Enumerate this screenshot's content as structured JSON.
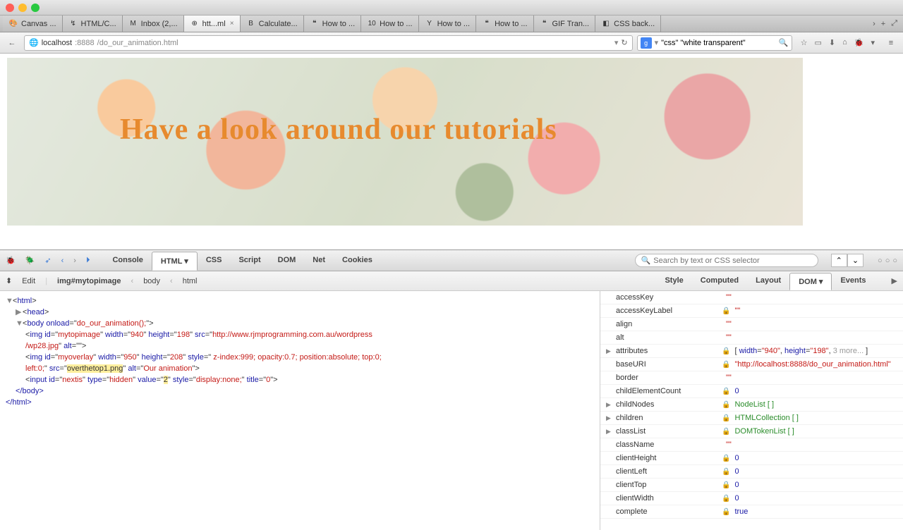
{
  "window": {
    "title": "Firefox"
  },
  "tabs": {
    "items": [
      {
        "label": "Canvas ...",
        "fav": "🎨"
      },
      {
        "label": "HTML/C...",
        "fav": "↯"
      },
      {
        "label": "Inbox (2,...",
        "fav": "M"
      },
      {
        "label": "htt...ml",
        "fav": "⊕",
        "active": true
      },
      {
        "label": "Calculate...",
        "fav": "B"
      },
      {
        "label": "How to ...",
        "fav": "❝"
      },
      {
        "label": "How to ...",
        "fav": "10"
      },
      {
        "label": "How to ...",
        "fav": "Y"
      },
      {
        "label": "How to ...",
        "fav": "❝"
      },
      {
        "label": "GIF Tran...",
        "fav": "❝"
      },
      {
        "label": "CSS back...",
        "fav": "◧"
      }
    ],
    "chev": "›",
    "plus": "+",
    "full": "⤢"
  },
  "addr": {
    "back": "←",
    "globe": "🌐",
    "host": "localhost",
    "port": ":8888",
    "path": "/do_our_animation.html",
    "reload": "↻",
    "dd": "▾"
  },
  "search": {
    "engine": "g",
    "value": "\"css\" \"white transparent\"",
    "go": "🔍"
  },
  "tbicons": [
    "☆",
    "▭",
    "⬇",
    "⌂",
    "🐞",
    "▾"
  ],
  "menu": "≡",
  "banner": {
    "text": "Have a look around our tutorials"
  },
  "devtools": {
    "leftIcons": [
      "🐞",
      "🪲",
      "🔍",
      "‹",
      "›",
      "⏵"
    ],
    "tabs": [
      "Console",
      "HTML",
      "CSS",
      "Script",
      "DOM",
      "Net",
      "Cookies"
    ],
    "activeTab": "HTML",
    "searchPlaceholder": "Search by text or CSS selector",
    "navUp": "⌃",
    "navDown": "⌄",
    "mini": [
      "○",
      "○",
      "○"
    ],
    "crumbs": {
      "edit": "Edit",
      "el": "img#mytopimage",
      "body": "body",
      "html": "html",
      "arrow": "‹"
    },
    "rightTabs": [
      "Style",
      "Computed",
      "Layout",
      "DOM",
      "Events"
    ],
    "rightActive": "DOM",
    "play": "▶"
  },
  "source": {
    "l1a": "<",
    "l1b": "html",
    "l1c": ">",
    "l2a": "<",
    "l2b": "head",
    "l2c": ">",
    "l3a": "<",
    "l3b": "body",
    "l3c": " onload",
    "l3d": "=\"",
    "l3e": "do_our_animation();",
    "l3f": "\">",
    "l4": "<img id=\"mytopimage\" width=\"940\" height=\"198\" src=\"http://www.rjmprogramming.com.au/wordpress/wp28.jpg\" alt=\"\">",
    "l5a": "<img id=\"myoverlay\" width=\"950\" height=\"208\" style=\" z-index:999; opacity:0.7; position:absolute; top:0; left:0;\" src=\"",
    "l5b": "overthetop1.png",
    "l5c": "\" alt=\"Our animation\">",
    "l6a": "<input id=\"nextis\" type=\"hidden\" value=\"",
    "l6b": "2",
    "l6c": "\" style=\"display:none;\" title=\"0\">",
    "l7": "</body>",
    "l8": "</html>"
  },
  "props": [
    {
      "k": "accessKey",
      "t": "str",
      "v": "\"\""
    },
    {
      "k": "accessKeyLabel",
      "t": "str",
      "v": "\"\"",
      "lock": true
    },
    {
      "k": "align",
      "t": "str",
      "v": "\"\""
    },
    {
      "k": "alt",
      "t": "str",
      "v": "\"\""
    },
    {
      "k": "attributes",
      "t": "attr",
      "v": "[ width=\"940\", height=\"198\", 3 more...]",
      "exp": true,
      "lock": true
    },
    {
      "k": "baseURI",
      "t": "str",
      "v": "\"http://localhost:8888/do_our_animation.html\"",
      "lock": true
    },
    {
      "k": "border",
      "t": "str",
      "v": "\"\""
    },
    {
      "k": "childElementCount",
      "t": "num",
      "v": "0",
      "lock": true
    },
    {
      "k": "childNodes",
      "t": "obj",
      "v": "NodeList [ ]",
      "exp": true,
      "lock": true
    },
    {
      "k": "children",
      "t": "obj",
      "v": "HTMLCollection [ ]",
      "exp": true,
      "lock": true
    },
    {
      "k": "classList",
      "t": "obj",
      "v": "DOMTokenList [ ]",
      "exp": true,
      "lock": true
    },
    {
      "k": "className",
      "t": "str",
      "v": "\"\""
    },
    {
      "k": "clientHeight",
      "t": "num",
      "v": "0",
      "lock": true
    },
    {
      "k": "clientLeft",
      "t": "num",
      "v": "0",
      "lock": true
    },
    {
      "k": "clientTop",
      "t": "num",
      "v": "0",
      "lock": true
    },
    {
      "k": "clientWidth",
      "t": "num",
      "v": "0",
      "lock": true
    },
    {
      "k": "complete",
      "t": "bool",
      "v": "true",
      "lock": true
    }
  ]
}
